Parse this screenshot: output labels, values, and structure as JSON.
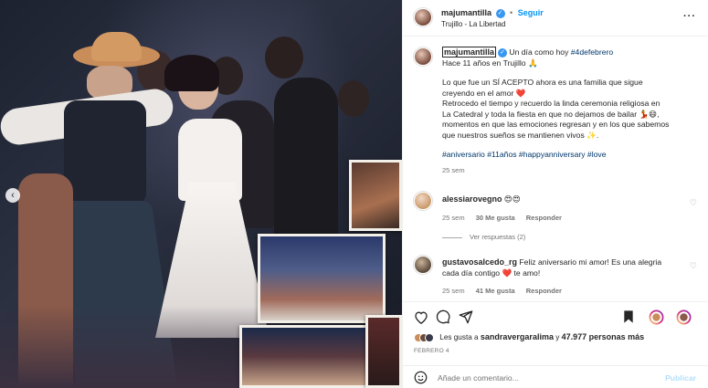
{
  "post": {
    "author": "majumantilla",
    "follow_label": "Seguir",
    "location": "Trujillo - La Libertad",
    "more_label": "···",
    "caption": {
      "author": "majumantilla",
      "line1_text": "Un día como hoy",
      "line1_tag": "#4defebrero",
      "line2": "Hace 11 años en Trujillo 🙏",
      "line3": "Lo que fue un SÍ ACEPTO ahora es una familia que sigue",
      "line4": "creyendo en el amor ❤️",
      "line5": "Retrocedo el tiempo y recuerdo la linda ceremonia religiosa en",
      "line6": "La Catedral y toda la fiesta en que no dejamos de bailar 💃😄,",
      "line7": "momentos en que las emociones regresan y en los que sabemos",
      "line8": "que nuestros sueños se mantienen vivos ✨.",
      "hashtags": "#aniversario #11años #happyanniversary #love",
      "time": "25 sem"
    },
    "comments": [
      {
        "author": "alessiarovegno",
        "text": "😍😍",
        "time": "25 sem",
        "likes": "30 Me gusta",
        "reply_label": "Responder",
        "view_replies": "Ver respuestas (2)"
      },
      {
        "author": "gustavosalcedo_rg",
        "text_line1": "Feliz aniversario mi amor! Es una alegria",
        "text_line2": "cada día contigo ❤️ te amo!",
        "time": "25 sem",
        "likes": "41 Me gusta",
        "reply_label": "Responder"
      }
    ],
    "likes_summary": {
      "prefix": "Les gusta a",
      "user": "sandravergaralima",
      "connector": "y",
      "count": "47.977 personas más"
    },
    "date": "FEBRERO 4",
    "add_comment_placeholder": "Añade un comentario...",
    "publish_label": "Publicar"
  },
  "icons": {
    "heart": "heart-icon",
    "comment": "comment-icon",
    "share": "share-icon",
    "save": "bookmark-icon",
    "emoji": "emoji-icon"
  },
  "colors": {
    "accent": "#0095f6",
    "verified": "#3897f0",
    "like_red": "#ed4956"
  }
}
